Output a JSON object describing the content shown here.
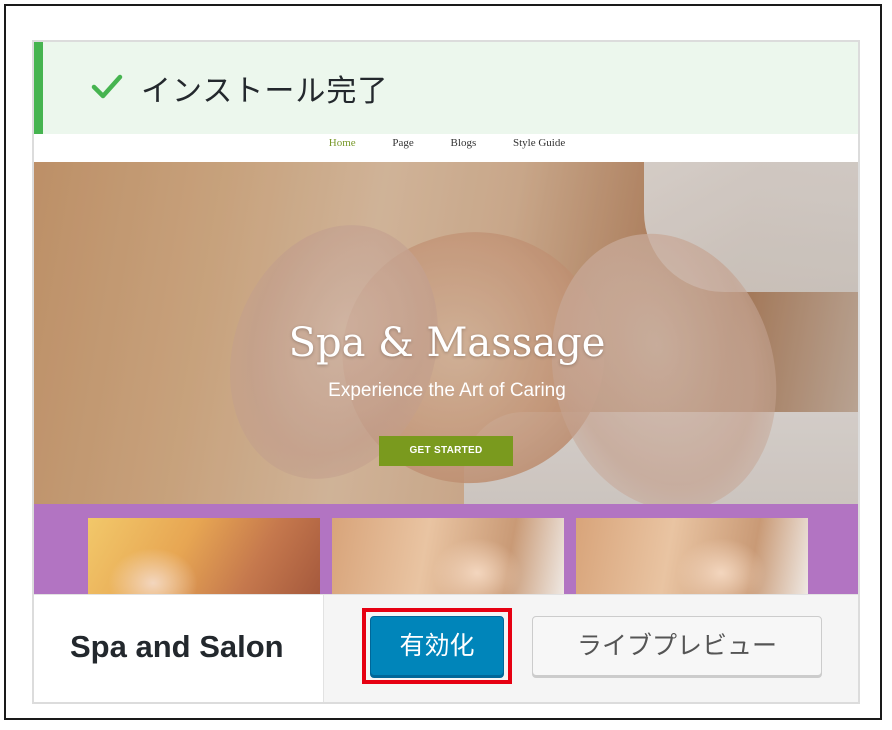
{
  "notice": {
    "icon": "checkmark-icon",
    "text": "インストール完了",
    "accent_color": "#46b450"
  },
  "preview": {
    "nav": [
      {
        "label": "Home",
        "active": true
      },
      {
        "label": "Page",
        "active": false
      },
      {
        "label": "Blogs",
        "active": false
      },
      {
        "label": "Style Guide",
        "active": false
      }
    ],
    "hero": {
      "title": "Spa & Massage",
      "subtitle": "Experience the Art of Caring",
      "button_label": "GET STARTED",
      "button_color": "#7a9a1e"
    },
    "thumb_band_color": "#b274c2"
  },
  "theme": {
    "name": "Spa and Salon"
  },
  "actions": {
    "activate_label": "有効化",
    "live_preview_label": "ライブプレビュー",
    "activate_color": "#0085ba",
    "highlight_color": "#e60012"
  }
}
